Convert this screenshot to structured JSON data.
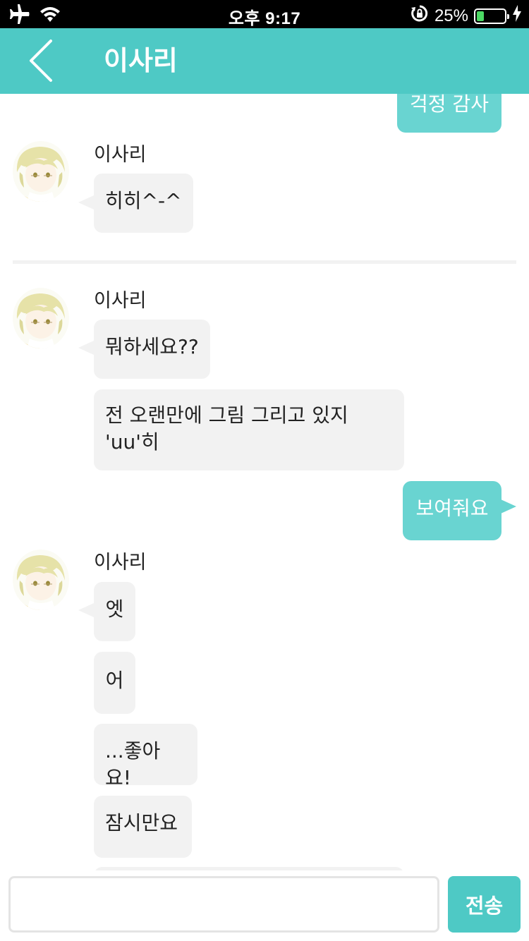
{
  "colors": {
    "accent": "#4ec9c5",
    "sent": "#69d4d1",
    "incoming_bubble": "#f2f2f2"
  },
  "status_bar": {
    "time": "오후 9:17",
    "battery_percent": 25,
    "battery_label": "25%",
    "icons": [
      "airplane-icon",
      "wifi-icon",
      "rotation-lock-icon",
      "battery-icon",
      "charging-icon"
    ]
  },
  "header": {
    "back_icon": "chevron-left-icon",
    "title": "이사리"
  },
  "messages": [
    {
      "direction": "out",
      "text": "걱정 감사"
    },
    {
      "direction": "in",
      "sender": "이사리",
      "text": "히히^-^"
    },
    {
      "direction": "in",
      "sender": "이사리",
      "text": "뭐하세요??"
    },
    {
      "direction": "in",
      "text_line1": "전 오랜만에 그림 그리고 있지",
      "text_line2": "'uu'히"
    },
    {
      "direction": "out",
      "text": "보여줘요"
    },
    {
      "direction": "in",
      "sender": "이사리",
      "text": "엣"
    },
    {
      "direction": "in",
      "text": "어"
    },
    {
      "direction": "in",
      "text": "...좋아요!"
    },
    {
      "direction": "in",
      "text": "잠시만요"
    }
  ],
  "input": {
    "value": "",
    "placeholder": ""
  },
  "send_label": "전송"
}
